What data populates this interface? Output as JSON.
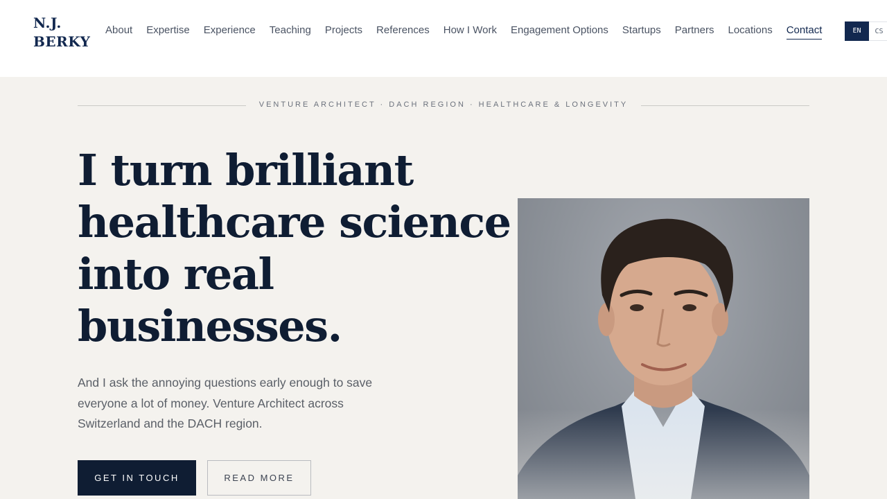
{
  "header": {
    "logo_line1": "N.J.",
    "logo_line2": "BERKY",
    "nav": [
      {
        "label": "About"
      },
      {
        "label": "Expertise"
      },
      {
        "label": "Experience"
      },
      {
        "label": "Teaching"
      },
      {
        "label": "Projects"
      },
      {
        "label": "References"
      },
      {
        "label": "How I Work"
      },
      {
        "label": "Engagement Options"
      },
      {
        "label": "Startups"
      },
      {
        "label": "Partners"
      },
      {
        "label": "Locations"
      },
      {
        "label": "Contact",
        "active": true
      }
    ],
    "lang": {
      "active": "EN",
      "other": "CS"
    }
  },
  "hero": {
    "eyebrow": "VENTURE ARCHITECT · DACH REGION · HEALTHCARE & LONGEVITY",
    "headline": [
      "I turn brilliant",
      "healthcare science",
      "into real",
      "businesses."
    ],
    "subtitle": [
      "And I ask the annoying questions early enough to save",
      "everyone a lot of money. Venture Architect across",
      "Switzerland and the DACH region."
    ],
    "primary_button": "GET IN TOUCH",
    "secondary_button": "READ MORE"
  },
  "colors": {
    "navy": "#0f1d33",
    "brand": "#12284f",
    "background": "#f4f2ee"
  }
}
